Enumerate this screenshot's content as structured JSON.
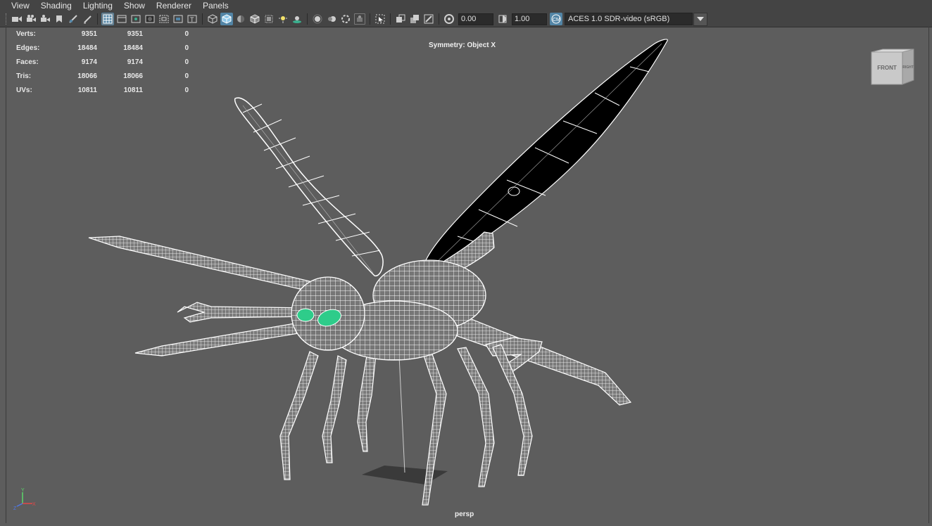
{
  "menu": {
    "view": "View",
    "shading": "Shading",
    "lighting": "Lighting",
    "show": "Show",
    "renderer": "Renderer",
    "panels": "Panels"
  },
  "toolbar": {
    "exposure": "0.00",
    "gamma": "1.00",
    "color_space": "ACES 1.0 SDR-video (sRGB)"
  },
  "hud": {
    "rows": [
      {
        "label": "Verts:",
        "v1": "9351",
        "v2": "9351",
        "v3": "0"
      },
      {
        "label": "Edges:",
        "v1": "18484",
        "v2": "18484",
        "v3": "0"
      },
      {
        "label": "Faces:",
        "v1": "9174",
        "v2": "9174",
        "v3": "0"
      },
      {
        "label": "Tris:",
        "v1": "18066",
        "v2": "18066",
        "v3": "0"
      },
      {
        "label": "UVs:",
        "v1": "10811",
        "v2": "10811",
        "v3": "0"
      }
    ]
  },
  "symmetry": "Symmetry: Object X",
  "camera": "persp",
  "viewcube": {
    "front": "FRONT",
    "right": "RIGHT"
  },
  "axis": {
    "x": "X",
    "y": "Y",
    "z": "Z"
  },
  "colors": {
    "viewport_bg": "#5d5d5d",
    "toolbar_bg": "#444444",
    "active_button": "#5285a6",
    "wireframe": "#ffffff",
    "selected_faces": "#000000",
    "eyes": "#2ecc8a"
  }
}
